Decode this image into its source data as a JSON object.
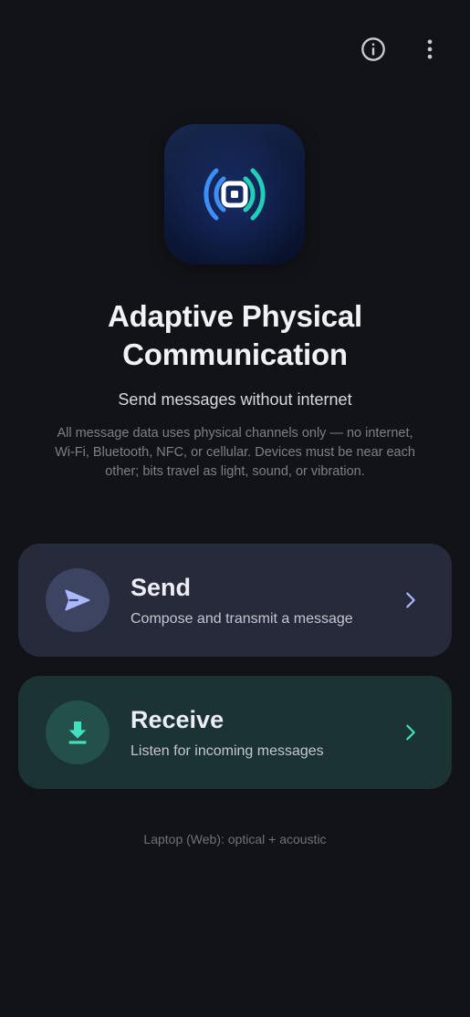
{
  "topbar": {
    "info_icon": "info-icon",
    "menu_icon": "more-vert-icon"
  },
  "app_icon": {
    "icon": "broadcast-signal-icon",
    "colors": {
      "left_wave": "#3d8ef7",
      "right_wave": "#1fcfb8",
      "center": "#ffffff"
    }
  },
  "header": {
    "title": "Adaptive Physical Communication",
    "subtitle": "Send messages without internet",
    "description": "All message data uses physical channels only — no internet, Wi-Fi, Bluetooth, NFC, or cellular. Devices must be near each other; bits travel as light, sound, or vibration."
  },
  "actions": {
    "send": {
      "title": "Send",
      "subtitle": "Compose and transmit a message",
      "icon": "send-icon",
      "accent": "#a9b8ff"
    },
    "receive": {
      "title": "Receive",
      "subtitle": "Listen for incoming messages",
      "icon": "download-icon",
      "accent": "#43e0c0"
    }
  },
  "footer": {
    "status": "Laptop (Web): optical + acoustic"
  }
}
